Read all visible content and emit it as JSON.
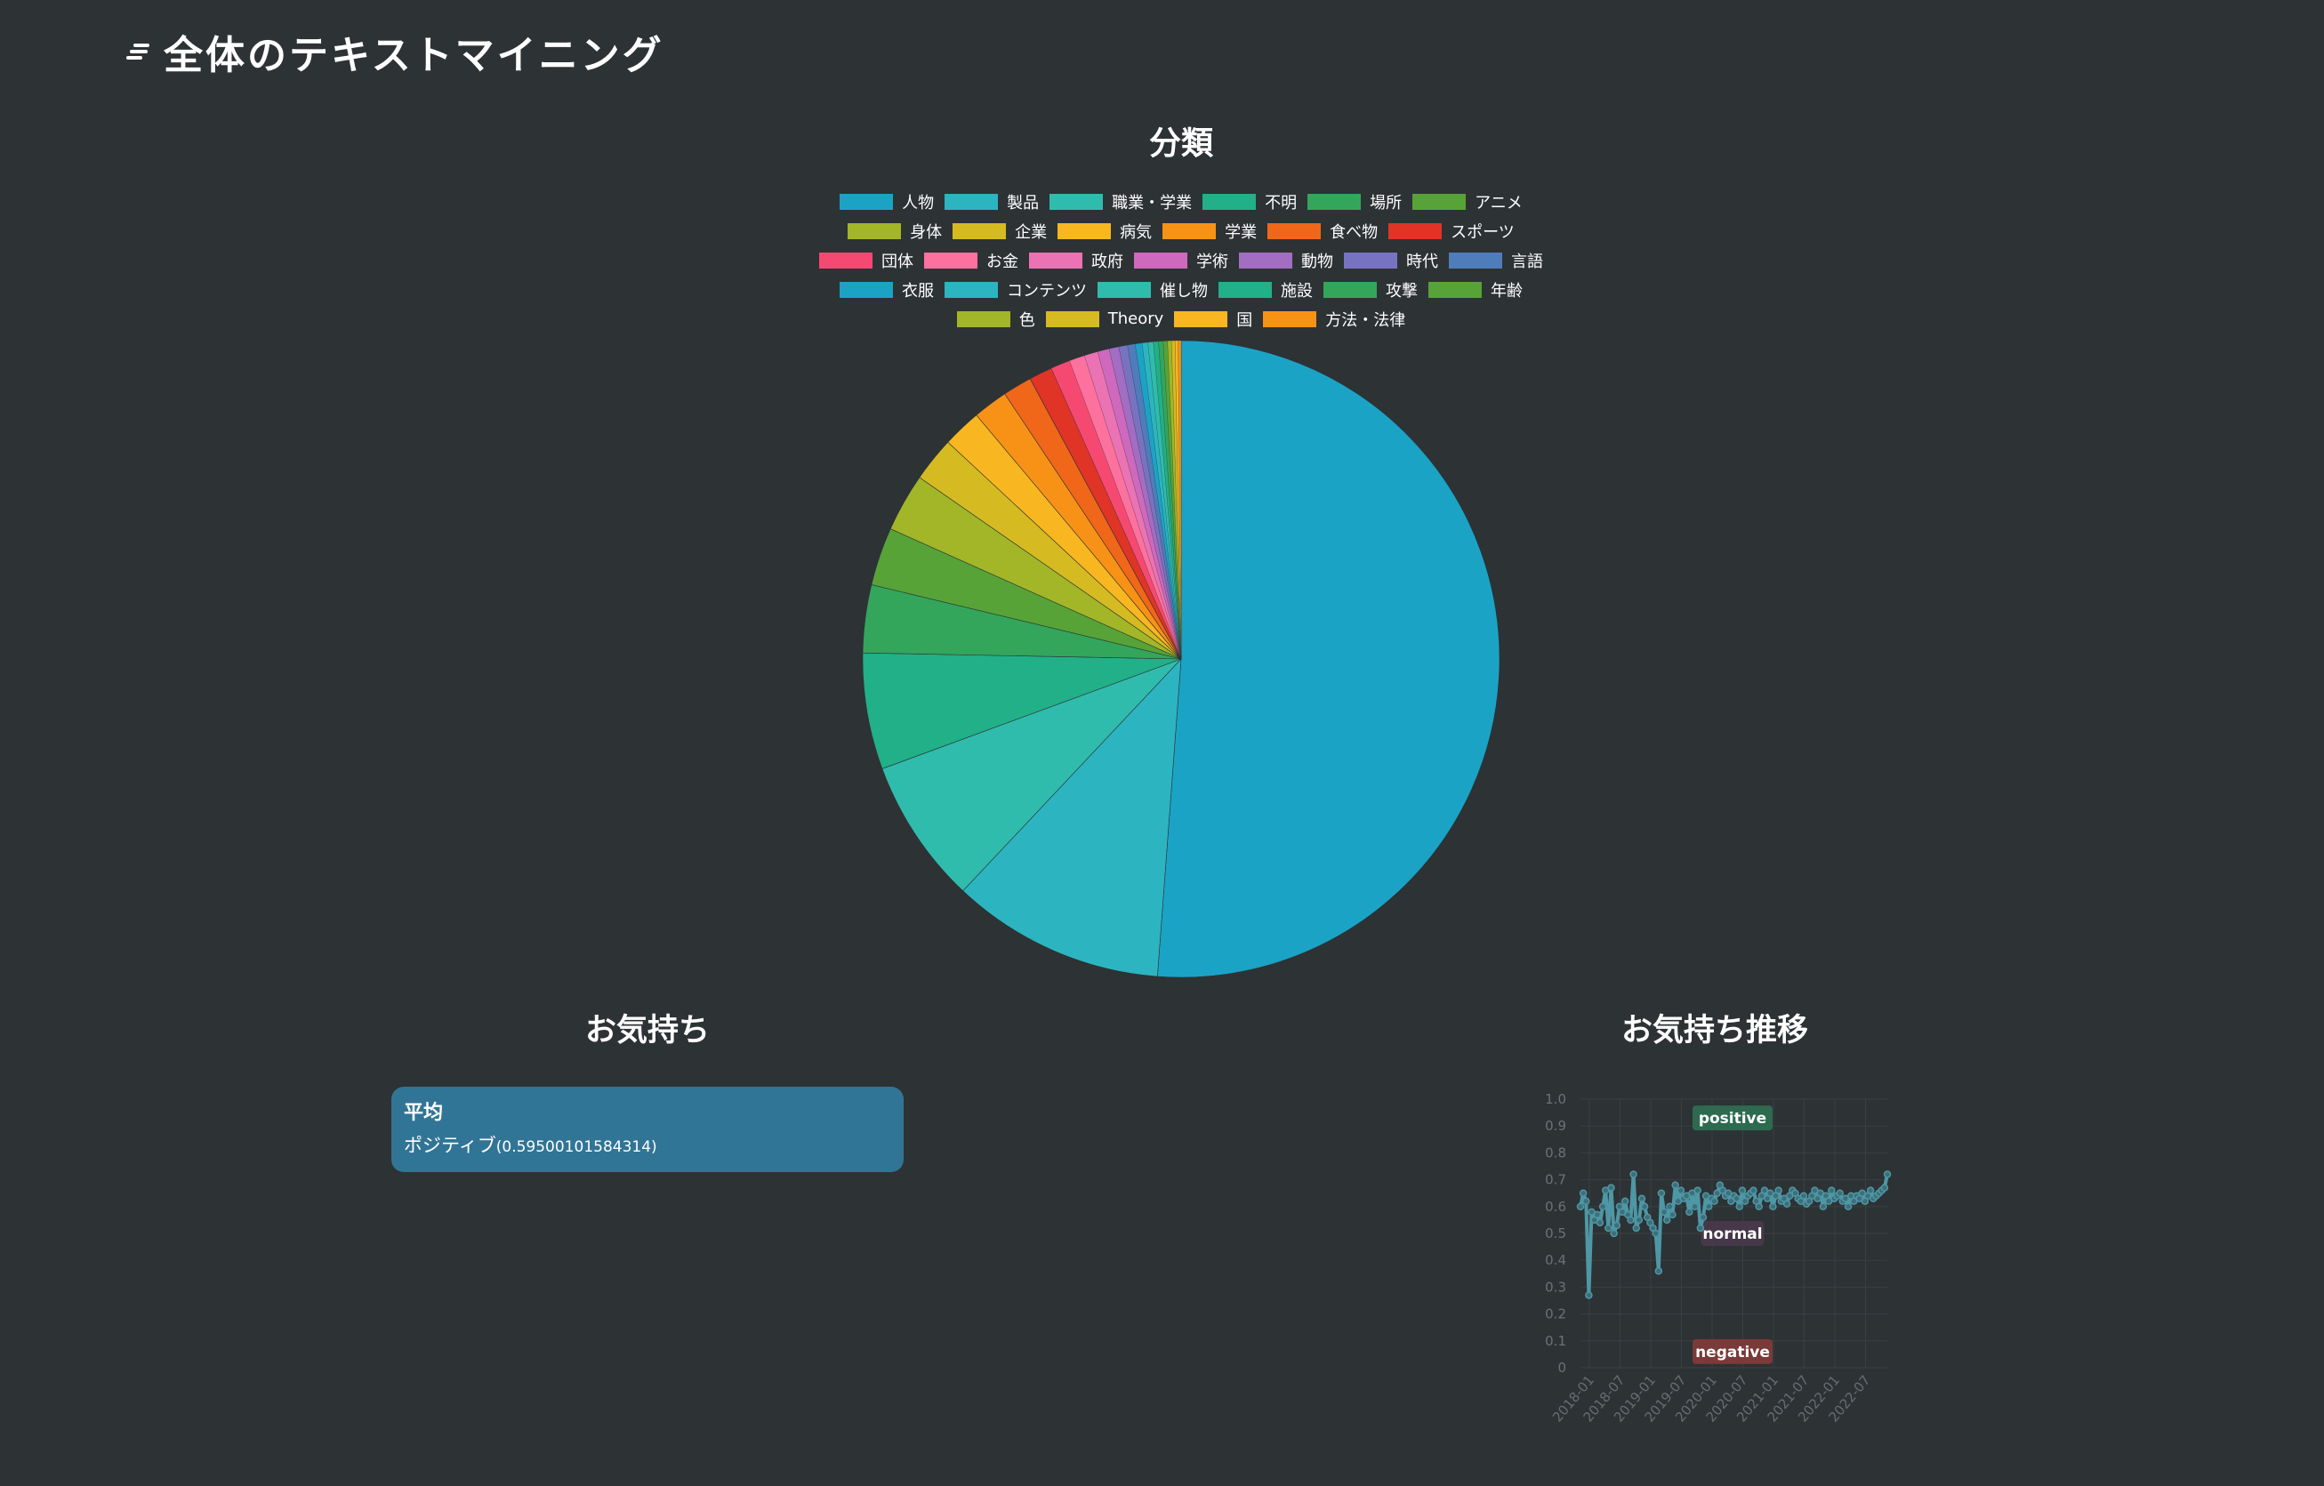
{
  "header": {
    "title": "全体のテキストマイニング",
    "icon": "stream-lines-icon"
  },
  "pie": {
    "title": "分類",
    "legend_rows": [
      [
        "人物",
        "製品",
        "職業・学業",
        "不明",
        "場所",
        "アニメ"
      ],
      [
        "身体",
        "企業",
        "病気",
        "学業",
        "食べ物",
        "スポーツ"
      ],
      [
        "団体",
        "お金",
        "政府",
        "学術",
        "動物",
        "時代",
        "言語"
      ],
      [
        "衣服",
        "コンテンツ",
        "催し物",
        "施設",
        "攻撃",
        "年齢"
      ],
      [
        "色",
        "Theory",
        "国",
        "方法・法律"
      ]
    ]
  },
  "mood": {
    "title": "お気持ち",
    "card_label": "平均",
    "card_value_label": "ポジティブ",
    "card_value_number": "(0.59500101584314)"
  },
  "trend": {
    "title": "お気持ち推移",
    "labels": {
      "positive": "positive",
      "normal": "normal",
      "negative": "negative"
    }
  },
  "colors": {
    "background": "#2d3235",
    "card": "#317596",
    "trend_line": "#4e97a5",
    "positive_badge": "#2d6a50",
    "normal_badge": "#463848",
    "negative_badge": "#7a3a38"
  },
  "chart_data": [
    {
      "type": "pie",
      "title": "分類",
      "legend_position": "top",
      "categories": [
        "人物",
        "製品",
        "職業・学業",
        "不明",
        "場所",
        "アニメ",
        "身体",
        "企業",
        "病気",
        "学業",
        "食べ物",
        "スポーツ",
        "団体",
        "お金",
        "政府",
        "学術",
        "動物",
        "時代",
        "言語",
        "衣服",
        "コンテンツ",
        "催し物",
        "施設",
        "攻撃",
        "年齢",
        "色",
        "Theory",
        "国",
        "方法・法律"
      ],
      "values": [
        52.0,
        11.0,
        7.5,
        6.0,
        3.5,
        3.0,
        3.0,
        2.3,
        2.0,
        1.8,
        1.5,
        1.2,
        1.0,
        0.8,
        0.7,
        0.6,
        0.5,
        0.45,
        0.4,
        0.35,
        0.3,
        0.28,
        0.26,
        0.24,
        0.22,
        0.2,
        0.18,
        0.16,
        0.15
      ],
      "colors": [
        "#1ba3c6",
        "#2cb5c0",
        "#30bcad",
        "#21b087",
        "#33a65c",
        "#57a337",
        "#a2b627",
        "#d5bb21",
        "#f8b620",
        "#f89217",
        "#f06719",
        "#e03426",
        "#f64971",
        "#fc719e",
        "#eb73b3",
        "#ce69be",
        "#a26dc2",
        "#7873c0",
        "#4f7cba",
        "#1ba3c6",
        "#2cb5c0",
        "#30bcad",
        "#21b087",
        "#33a65c",
        "#57a337",
        "#a2b627",
        "#d5bb21",
        "#f8b620",
        "#f89217"
      ]
    },
    {
      "type": "line",
      "title": "お気持ち推移",
      "ylim": [
        0,
        1.0
      ],
      "y_ticks": [
        "0",
        "0.1",
        "0.2",
        "0.3",
        "0.4",
        "0.5",
        "0.6",
        "0.7",
        "0.8",
        "0.9",
        "1.0"
      ],
      "x_ticks": [
        "2018-01",
        "2018-07",
        "2019-01",
        "2019-07",
        "2020-01",
        "2020-07",
        "2021-01",
        "2021-07",
        "2022-01",
        "2022-07"
      ],
      "grid": true,
      "annotations": [
        {
          "label": "positive",
          "y": 0.93
        },
        {
          "label": "normal",
          "y": 0.5
        },
        {
          "label": "negative",
          "y": 0.06
        }
      ],
      "series": [
        {
          "x": [
            0,
            0.5,
            1,
            1.5,
            2,
            2.5,
            3,
            3.5,
            4,
            4.5,
            5,
            5.5,
            6,
            6.5,
            7,
            7.5,
            8,
            8.5,
            9,
            9.5,
            10,
            10.5,
            11,
            11.5,
            12,
            12.5,
            13,
            13.5,
            14,
            14.5,
            15,
            15.5,
            16,
            16.5,
            17,
            17.5,
            18,
            18.5,
            19,
            19.5,
            20,
            20.5,
            21,
            21.5,
            22,
            22.5,
            23,
            23.5,
            24,
            24.5,
            25,
            25.5,
            26,
            26.5,
            27,
            27.5,
            28,
            28.5,
            29,
            29.5,
            30,
            30.5,
            31,
            31.5,
            32,
            32.5,
            33,
            33.5,
            34,
            34.5,
            35,
            35.5,
            36,
            36.5,
            37,
            37.5,
            38,
            38.5,
            39,
            39.5,
            40,
            40.5,
            41,
            41.5,
            42,
            42.5,
            43,
            43.5,
            44,
            44.5,
            45,
            45.5,
            46,
            46.5,
            47,
            47.5,
            48,
            48.5,
            49,
            49.5,
            50,
            50.5,
            51,
            51.5,
            52,
            52.5,
            53,
            53.5,
            54,
            54.5,
            55
          ],
          "y": [
            0.6,
            0.65,
            0.62,
            0.27,
            0.58,
            0.55,
            0.57,
            0.54,
            0.6,
            0.66,
            0.52,
            0.67,
            0.5,
            0.53,
            0.6,
            0.58,
            0.62,
            0.57,
            0.55,
            0.72,
            0.52,
            0.55,
            0.63,
            0.6,
            0.56,
            0.54,
            0.52,
            0.5,
            0.36,
            0.65,
            0.58,
            0.55,
            0.6,
            0.57,
            0.68,
            0.62,
            0.66,
            0.63,
            0.64,
            0.58,
            0.65,
            0.6,
            0.66,
            0.52,
            0.56,
            0.64,
            0.6,
            0.63,
            0.62,
            0.65,
            0.68,
            0.66,
            0.64,
            0.65,
            0.62,
            0.64,
            0.63,
            0.6,
            0.66,
            0.62,
            0.64,
            0.65,
            0.66,
            0.62,
            0.6,
            0.64,
            0.66,
            0.63,
            0.65,
            0.6,
            0.64,
            0.66,
            0.62,
            0.63,
            0.61,
            0.64,
            0.66,
            0.65,
            0.63,
            0.62,
            0.64,
            0.61,
            0.62,
            0.64,
            0.66,
            0.63,
            0.65,
            0.6,
            0.64,
            0.62,
            0.66,
            0.63,
            0.64,
            0.65,
            0.62,
            0.63,
            0.6,
            0.64,
            0.62,
            0.64,
            0.63,
            0.65,
            0.62,
            0.64,
            0.66,
            0.63,
            0.64,
            0.65,
            0.66,
            0.67,
            0.72
          ]
        }
      ]
    }
  ]
}
